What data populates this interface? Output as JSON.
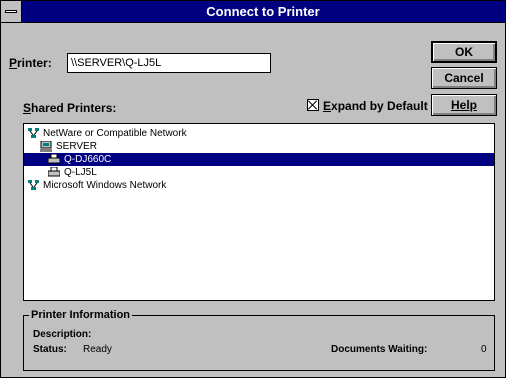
{
  "window": {
    "title": "Connect to Printer"
  },
  "printer_field": {
    "label_accel": "P",
    "label_rest": "rinter:",
    "value": "\\\\SERVER\\Q-LJ5L"
  },
  "buttons": {
    "ok": "OK",
    "cancel": "Cancel",
    "help": "Help"
  },
  "shared_printers": {
    "label_accel": "S",
    "label_rest": "hared Printers:"
  },
  "expand_default": {
    "checked": true,
    "label_accel": "E",
    "label_rest": "xpand by Default"
  },
  "tree": {
    "network_netware": "NetWare or Compatible Network",
    "server": "SERVER",
    "printer_selected": "Q-DJ660C",
    "printer_other": "Q-LJ5L",
    "network_ms": "Microsoft Windows Network"
  },
  "printer_info": {
    "title": "Printer Information",
    "description_label": "Description:",
    "status_label": "Status:",
    "status_value": "Ready",
    "docs_label": "Documents Waiting:",
    "docs_value": "0"
  },
  "icons": {
    "system_menu": "system-menu-icon",
    "network": "network-icon",
    "server": "server-icon",
    "printer": "printer-icon"
  },
  "colors": {
    "title_bar": "#000080",
    "selection": "#000080",
    "face": "#c0c0c0"
  }
}
